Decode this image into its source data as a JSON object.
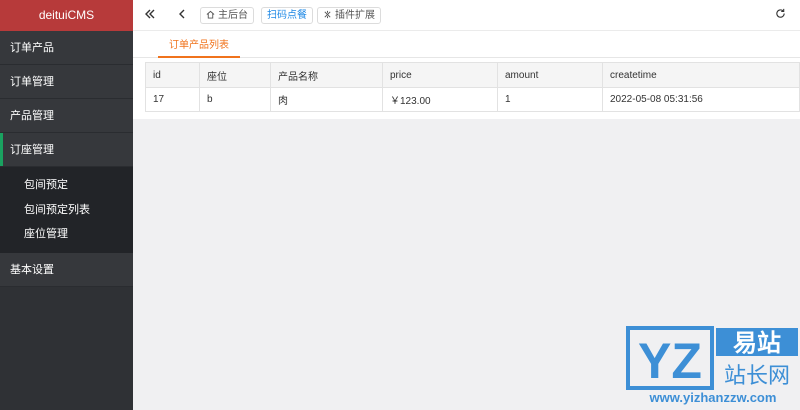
{
  "app": {
    "title": "deituiCMS"
  },
  "sidebar": {
    "items": [
      {
        "label": "订单产品"
      },
      {
        "label": "订单管理"
      },
      {
        "label": "产品管理"
      },
      {
        "label": "订座管理"
      }
    ],
    "sub_items": [
      {
        "label": "包间预定"
      },
      {
        "label": "包间预定列表"
      },
      {
        "label": "座位管理"
      }
    ],
    "bottom_item": {
      "label": "基本设置"
    }
  },
  "topbar": {
    "home_label": "主后台",
    "scan_label": "扫码点餐",
    "plugin_label": "插件扩展"
  },
  "tabs": [
    {
      "label": "订单产品列表"
    }
  ],
  "table": {
    "headers": [
      "id",
      "座位",
      "产品名称",
      "price",
      "amount",
      "createtime"
    ],
    "rows": [
      [
        "17",
        "b",
        "肉",
        "￥123.00",
        "1",
        "2022-05-08 05:31:56"
      ]
    ]
  },
  "watermark": {
    "logo_letters": "YZ",
    "cn_top": "易站",
    "cn_bottom": "站长网",
    "url": "www.yizhanzzw.com",
    "color": "#3d8fd6"
  }
}
